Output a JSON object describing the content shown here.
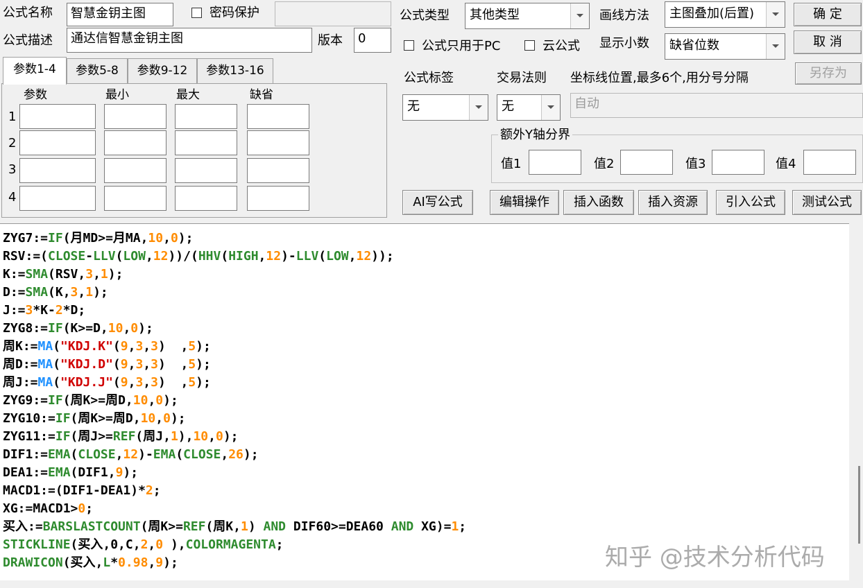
{
  "header": {
    "name_label": "公式名称",
    "name_value": "智慧金钥主图",
    "password_label": "密码保护",
    "desc_label": "公式描述",
    "desc_value": "通达信智慧金钥主图",
    "version_label": "版本",
    "version_value": "0"
  },
  "options": {
    "type_label": "公式类型",
    "type_value": "其他类型",
    "draw_label": "画线方法",
    "draw_value": "主图叠加(后置)",
    "pc_only_label": "公式只用于PC",
    "cloud_label": "云公式",
    "decimals_label": "显示小数",
    "decimals_value": "缺省位数",
    "tag_label": "公式标签",
    "tag_value": "无",
    "rule_label": "交易法则",
    "rule_value": "无",
    "axis_label": "坐标线位置,最多6个,用分号分隔",
    "axis_placeholder": "自动",
    "ybound_label": "额外Y轴分界",
    "values": [
      "值1",
      "值2",
      "值3",
      "值4"
    ]
  },
  "buttons": {
    "ok": "确  定",
    "cancel": "取  消",
    "save_as": "另存为",
    "ai": "AI写公式",
    "edit": "编辑操作",
    "insert_func": "插入函数",
    "insert_res": "插入资源",
    "import": "引入公式",
    "test": "测试公式"
  },
  "tabs": [
    "参数1-4",
    "参数5-8",
    "参数9-12",
    "参数13-16"
  ],
  "params": {
    "headers": [
      "参数",
      "最小",
      "最大",
      "缺省"
    ],
    "rows": [
      "1",
      "2",
      "3",
      "4"
    ]
  },
  "colors": {
    "keyword": "#2e8b2e",
    "function_blue": "#1e90ff",
    "number": "#ff8c00",
    "string": "#d00000",
    "text": "#000000"
  },
  "code_lines": [
    [
      [
        "ZYG7:=",
        "t"
      ],
      [
        "IF",
        "k"
      ],
      [
        "(月MD>=月MA,",
        "t"
      ],
      [
        "10",
        "n"
      ],
      [
        ",",
        "t"
      ],
      [
        "0",
        "n"
      ],
      [
        ");",
        "t"
      ]
    ],
    [
      [
        "RSV:=(",
        "t"
      ],
      [
        "CLOSE",
        "k"
      ],
      [
        "-",
        "t"
      ],
      [
        "LLV",
        "k"
      ],
      [
        "(",
        "t"
      ],
      [
        "LOW",
        "k"
      ],
      [
        ",",
        "t"
      ],
      [
        "12",
        "n"
      ],
      [
        "))/(",
        "t"
      ],
      [
        "HHV",
        "k"
      ],
      [
        "(",
        "t"
      ],
      [
        "HIGH",
        "k"
      ],
      [
        ",",
        "t"
      ],
      [
        "12",
        "n"
      ],
      [
        ")-",
        "t"
      ],
      [
        "LLV",
        "k"
      ],
      [
        "(",
        "t"
      ],
      [
        "LOW",
        "k"
      ],
      [
        ",",
        "t"
      ],
      [
        "12",
        "n"
      ],
      [
        "));",
        "t"
      ]
    ],
    [
      [
        "K:=",
        "t"
      ],
      [
        "SMA",
        "k"
      ],
      [
        "(RSV,",
        "t"
      ],
      [
        "3",
        "n"
      ],
      [
        ",",
        "t"
      ],
      [
        "1",
        "n"
      ],
      [
        ");",
        "t"
      ]
    ],
    [
      [
        "D:=",
        "t"
      ],
      [
        "SMA",
        "k"
      ],
      [
        "(K,",
        "t"
      ],
      [
        "3",
        "n"
      ],
      [
        ",",
        "t"
      ],
      [
        "1",
        "n"
      ],
      [
        ");",
        "t"
      ]
    ],
    [
      [
        "J:=",
        "t"
      ],
      [
        "3",
        "n"
      ],
      [
        "*K-",
        "t"
      ],
      [
        "2",
        "n"
      ],
      [
        "*D;",
        "t"
      ]
    ],
    [
      [
        "ZYG8:=",
        "t"
      ],
      [
        "IF",
        "k"
      ],
      [
        "(K>=D,",
        "t"
      ],
      [
        "10",
        "n"
      ],
      [
        ",",
        "t"
      ],
      [
        "0",
        "n"
      ],
      [
        ");",
        "t"
      ]
    ],
    [
      [
        "周K:=",
        "t"
      ],
      [
        "MA",
        "b"
      ],
      [
        "(",
        "t"
      ],
      [
        "\"KDJ.K\"",
        "s"
      ],
      [
        "(",
        "t"
      ],
      [
        "9",
        "n"
      ],
      [
        ",",
        "t"
      ],
      [
        "3",
        "n"
      ],
      [
        ",",
        "t"
      ],
      [
        "3",
        "n"
      ],
      [
        ")  ,",
        "t"
      ],
      [
        "5",
        "n"
      ],
      [
        ");",
        "t"
      ]
    ],
    [
      [
        "周D:=",
        "t"
      ],
      [
        "MA",
        "b"
      ],
      [
        "(",
        "t"
      ],
      [
        "\"KDJ.D\"",
        "s"
      ],
      [
        "(",
        "t"
      ],
      [
        "9",
        "n"
      ],
      [
        ",",
        "t"
      ],
      [
        "3",
        "n"
      ],
      [
        ",",
        "t"
      ],
      [
        "3",
        "n"
      ],
      [
        ")  ,",
        "t"
      ],
      [
        "5",
        "n"
      ],
      [
        ");",
        "t"
      ]
    ],
    [
      [
        "周J:=",
        "t"
      ],
      [
        "MA",
        "b"
      ],
      [
        "(",
        "t"
      ],
      [
        "\"KDJ.J\"",
        "s"
      ],
      [
        "(",
        "t"
      ],
      [
        "9",
        "n"
      ],
      [
        ",",
        "t"
      ],
      [
        "3",
        "n"
      ],
      [
        ",",
        "t"
      ],
      [
        "3",
        "n"
      ],
      [
        ")  ,",
        "t"
      ],
      [
        "5",
        "n"
      ],
      [
        ");",
        "t"
      ]
    ],
    [
      [
        "ZYG9:=",
        "t"
      ],
      [
        "IF",
        "k"
      ],
      [
        "(周K>=周D,",
        "t"
      ],
      [
        "10",
        "n"
      ],
      [
        ",",
        "t"
      ],
      [
        "0",
        "n"
      ],
      [
        ");",
        "t"
      ]
    ],
    [
      [
        "ZYG10:=",
        "t"
      ],
      [
        "IF",
        "k"
      ],
      [
        "(周K>=周D,",
        "t"
      ],
      [
        "10",
        "n"
      ],
      [
        ",",
        "t"
      ],
      [
        "0",
        "n"
      ],
      [
        ");",
        "t"
      ]
    ],
    [
      [
        "ZYG11:=",
        "t"
      ],
      [
        "IF",
        "k"
      ],
      [
        "(周J>=",
        "t"
      ],
      [
        "REF",
        "k"
      ],
      [
        "(周J,",
        "t"
      ],
      [
        "1",
        "n"
      ],
      [
        "),",
        "t"
      ],
      [
        "10",
        "n"
      ],
      [
        ",",
        "t"
      ],
      [
        "0",
        "n"
      ],
      [
        ");",
        "t"
      ]
    ],
    [
      [
        "DIF1:=",
        "t"
      ],
      [
        "EMA",
        "k"
      ],
      [
        "(",
        "t"
      ],
      [
        "CLOSE",
        "k"
      ],
      [
        ",",
        "t"
      ],
      [
        "12",
        "n"
      ],
      [
        ")-",
        "t"
      ],
      [
        "EMA",
        "k"
      ],
      [
        "(",
        "t"
      ],
      [
        "CLOSE",
        "k"
      ],
      [
        ",",
        "t"
      ],
      [
        "26",
        "n"
      ],
      [
        ");",
        "t"
      ]
    ],
    [
      [
        "DEA1:=",
        "t"
      ],
      [
        "EMA",
        "k"
      ],
      [
        "(DIF1,",
        "t"
      ],
      [
        "9",
        "n"
      ],
      [
        ");",
        "t"
      ]
    ],
    [
      [
        "MACD1:=(DIF1-DEA1)*",
        "t"
      ],
      [
        "2",
        "n"
      ],
      [
        ";",
        "t"
      ]
    ],
    [
      [
        "XG:=MACD1>",
        "t"
      ],
      [
        "0",
        "n"
      ],
      [
        ";",
        "t"
      ]
    ],
    [
      [
        "买入:=",
        "t"
      ],
      [
        "BARSLASTCOUNT",
        "k"
      ],
      [
        "(周K>=",
        "t"
      ],
      [
        "REF",
        "k"
      ],
      [
        "(周K,",
        "t"
      ],
      [
        "1",
        "n"
      ],
      [
        ") ",
        "t"
      ],
      [
        "AND",
        "k"
      ],
      [
        " DIF60>=DEA60 ",
        "t"
      ],
      [
        "AND",
        "k"
      ],
      [
        " XG)=",
        "t"
      ],
      [
        "1",
        "n"
      ],
      [
        ";",
        "t"
      ]
    ],
    [
      [
        "STICKLINE",
        "k"
      ],
      [
        "(买入,0,C,",
        "t"
      ],
      [
        "2",
        "n"
      ],
      [
        ",",
        "t"
      ],
      [
        "0",
        "n"
      ],
      [
        " ),",
        "t"
      ],
      [
        "COLORMAGENTA",
        "k"
      ],
      [
        ";",
        "t"
      ]
    ],
    [
      [
        "DRAWICON",
        "k"
      ],
      [
        "(买入,",
        "t"
      ],
      [
        "L",
        "k"
      ],
      [
        "*",
        "t"
      ],
      [
        "0.98",
        "n"
      ],
      [
        ",",
        "t"
      ],
      [
        "9",
        "n"
      ],
      [
        ");",
        "t"
      ]
    ]
  ],
  "watermark": "知乎 @技术分析代码"
}
